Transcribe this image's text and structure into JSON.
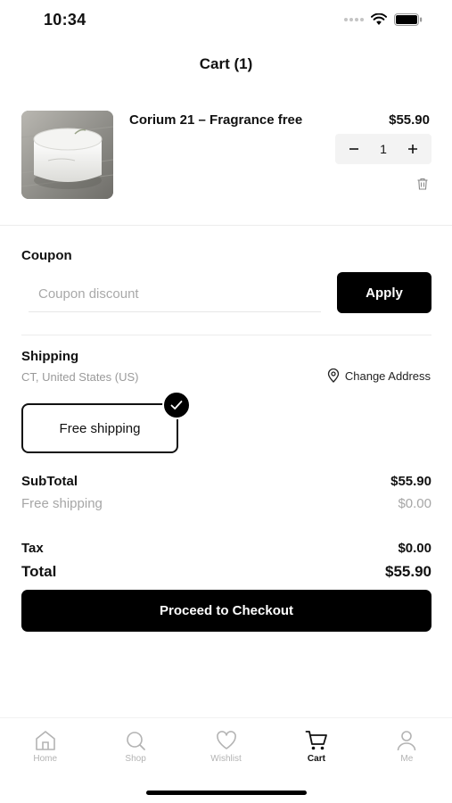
{
  "status_bar": {
    "time": "10:34"
  },
  "header": {
    "title": "Cart (1)"
  },
  "cart_items": [
    {
      "name": "Corium 21 – Fragrance free",
      "price": "$55.90",
      "quantity": "1",
      "image_icon": "product-jar-image"
    }
  ],
  "coupon": {
    "label": "Coupon",
    "placeholder": "Coupon discount",
    "value": "",
    "apply_label": "Apply"
  },
  "shipping": {
    "label": "Shipping",
    "location": "CT, United States (US)",
    "change_address_label": "Change Address",
    "selected_option": "Free shipping"
  },
  "summary": {
    "subtotal_label": "SubTotal",
    "subtotal_value": "$55.90",
    "shipping_label": "Free shipping",
    "shipping_value": "$0.00",
    "tax_label": "Tax",
    "tax_value": "$0.00",
    "total_label": "Total",
    "total_value": "$55.90"
  },
  "checkout": {
    "label": "Proceed to Checkout"
  },
  "tab_bar": {
    "tabs": [
      {
        "label": "Home",
        "icon": "home-icon",
        "active": false
      },
      {
        "label": "Shop",
        "icon": "search-icon",
        "active": false
      },
      {
        "label": "Wishlist",
        "icon": "heart-icon",
        "active": false
      },
      {
        "label": "Cart",
        "icon": "cart-icon",
        "active": true
      },
      {
        "label": "Me",
        "icon": "user-icon",
        "active": false
      }
    ]
  },
  "colors": {
    "primary": "#000000",
    "muted_text": "#a6a6a6",
    "inactive_tab": "#b3b3b3",
    "stepper_bg": "#f3f3f3"
  }
}
